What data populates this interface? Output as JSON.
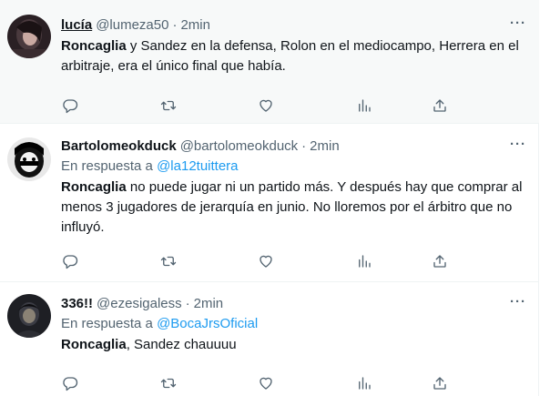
{
  "colors": {
    "accent": "#1d9bf0",
    "muted": "#536471",
    "text": "#0f1419",
    "highlight_bg": "#f7f9f9"
  },
  "tweets": [
    {
      "name": "lucía",
      "handle": "@lumeza50",
      "separator": "·",
      "time": "2min",
      "more": "···",
      "reply_prefix": "",
      "reply_to": "",
      "text_bold": "Roncaglia",
      "text_rest": " y Sandez en la defensa, Rolon en el mediocampo, Herrera en el arbitraje, era el único final que había.",
      "actions": [
        "reply-icon",
        "retweet-icon",
        "like-icon",
        "views-icon",
        "share-icon"
      ]
    },
    {
      "name": "Bartolomeokduck",
      "handle": "@bartolomeokduck",
      "separator": "·",
      "time": "2min",
      "more": "···",
      "reply_prefix": "En respuesta a ",
      "reply_to": "@la12tuittera",
      "text_bold": "Roncaglia",
      "text_rest": " no puede jugar ni un partido más. Y después hay que comprar al menos 3 jugadores de jerarquía en junio. No lloremos por el árbitro que no influyó.",
      "actions": [
        "reply-icon",
        "retweet-icon",
        "like-icon",
        "views-icon",
        "share-icon"
      ]
    },
    {
      "name": "336!!",
      "handle": "@ezesigaless",
      "separator": "·",
      "time": "2min",
      "more": "···",
      "reply_prefix": "En respuesta a ",
      "reply_to": "@BocaJrsOficial",
      "text_bold": "Roncaglia",
      "text_rest": ", Sandez chauuuu",
      "actions": [
        "reply-icon",
        "retweet-icon",
        "like-icon",
        "views-icon",
        "share-icon"
      ]
    }
  ]
}
